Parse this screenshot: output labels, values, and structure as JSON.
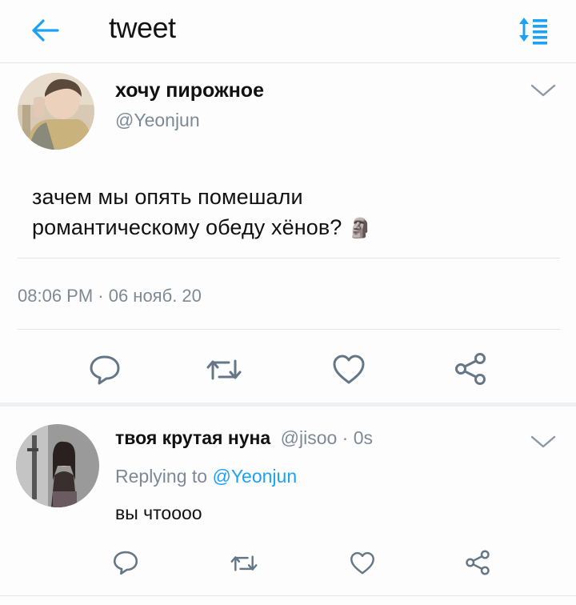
{
  "header": {
    "title": "tweet",
    "back_icon": "arrow-left-icon",
    "sort_icon": "sort-list-icon",
    "accent": "#1da1f2"
  },
  "main_tweet": {
    "display_name": "хочу пирожное",
    "handle": "@Yeonjun",
    "text_line1": "зачем мы опять помешали",
    "text_line2": "романтическому обеду хёнов?",
    "emoji": "🗿",
    "timestamp": "08:06 PM · 06 нояб. 20",
    "actions": [
      "reply-icon",
      "retweet-icon",
      "like-icon",
      "share-icon"
    ]
  },
  "reply_tweet": {
    "display_name": "твоя крутая нуна",
    "handle": "@jisoo",
    "separator": "·",
    "time": "0s",
    "replying_to_label": "Replying to",
    "replying_to_handle": "@Yeonjun",
    "text": "вы чтоооо",
    "actions": [
      "reply-icon",
      "retweet-icon",
      "like-icon",
      "share-icon"
    ]
  },
  "colors": {
    "text": "#111111",
    "secondary": "#7d8a96",
    "divider": "#e3e6e9",
    "icon_gray": "#657786"
  }
}
